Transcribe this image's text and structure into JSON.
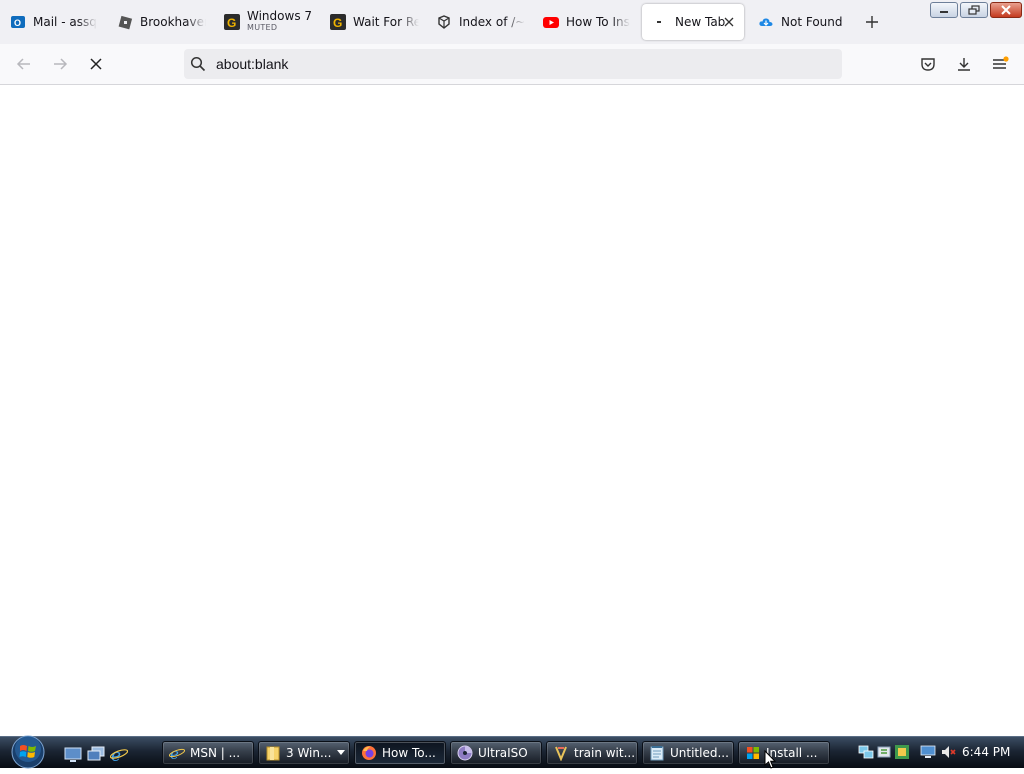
{
  "browser": {
    "tabs": [
      {
        "title": "Mail - assqq",
        "icon": "outlook-icon"
      },
      {
        "title": "Brookhaven",
        "icon": "roblox-icon"
      },
      {
        "title": "Windows 7",
        "subtitle": "MUTED",
        "icon": "g-icon"
      },
      {
        "title": "Wait For Re",
        "icon": "g-icon"
      },
      {
        "title": "Index of /~c",
        "icon": "index-icon"
      },
      {
        "title": "How To Inst",
        "icon": "youtube-icon"
      },
      {
        "title": "New Tab",
        "icon": "dot-icon",
        "active": true
      },
      {
        "title": "Not Found",
        "icon": "cloud-icon"
      }
    ],
    "url": "about:blank",
    "colors": {
      "tabstrip": "#f0f0f4",
      "navbar": "#f9f9fb",
      "urlbar": "#ececef",
      "youtube": "#ff0000",
      "outlook": "#0f6cbd"
    }
  },
  "taskbar": {
    "tasks": [
      {
        "label": "MSN | ...",
        "icon": "ie-icon"
      },
      {
        "label": "3 Win...",
        "icon": "folder-icon"
      },
      {
        "label": "How To...",
        "icon": "firefox-icon",
        "active": true
      },
      {
        "label": "UltraISO",
        "icon": "disc-icon"
      },
      {
        "label": "train wit...",
        "icon": "gem-icon"
      },
      {
        "label": "Untitled...",
        "icon": "notepad-icon"
      },
      {
        "label": "Install ...",
        "icon": "windows-flag-icon"
      }
    ],
    "clock": "6:44 PM"
  }
}
